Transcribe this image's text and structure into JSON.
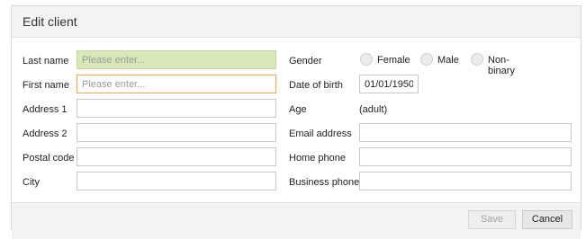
{
  "dialog": {
    "title": "Edit client",
    "save_label": "Save",
    "cancel_label": "Cancel"
  },
  "left_column": {
    "last_name": {
      "label": "Last name",
      "value": "",
      "placeholder": "Please enter..."
    },
    "first_name": {
      "label": "First name",
      "value": "",
      "placeholder": "Please enter..."
    },
    "address1": {
      "label": "Address 1",
      "value": ""
    },
    "address2": {
      "label": "Address 2",
      "value": ""
    },
    "postal_code": {
      "label": "Postal code",
      "value": ""
    },
    "city": {
      "label": "City",
      "value": ""
    }
  },
  "right_column": {
    "gender": {
      "label": "Gender",
      "options": [
        "Female",
        "Male",
        "Non-binary"
      ],
      "selected": null
    },
    "date_of_birth": {
      "label": "Date of birth",
      "value": "01/01/1950"
    },
    "age": {
      "label": "Age",
      "value": "(adult)"
    },
    "email": {
      "label": "Email address",
      "value": ""
    },
    "home_phone": {
      "label": "Home phone",
      "value": ""
    },
    "business_phone": {
      "label": "Business phone",
      "value": ""
    }
  },
  "colors": {
    "active_field_bg": "#d8e8b8",
    "focused_field_border": "#f0a35a",
    "header_bg": "#f3f3f3"
  }
}
